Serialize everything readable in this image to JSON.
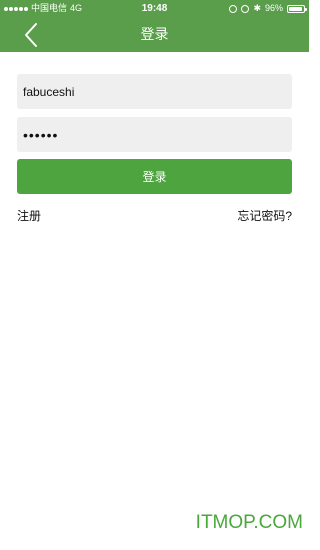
{
  "status_bar": {
    "carrier": "中国电信",
    "network": "4G",
    "time": "19:48",
    "battery": "96%",
    "battery_level": 0.96
  },
  "nav": {
    "title": "登录",
    "back_icon": "chevron-left-icon"
  },
  "form": {
    "username_value": "fabuceshi",
    "password_value": "••••••",
    "login_label": "登录"
  },
  "links": {
    "register": "注册",
    "forgot_password": "忘记密码?"
  },
  "watermark": "ITMOP.COM",
  "colors": {
    "header": "#5a9e4b",
    "button": "#4ea540",
    "field_bg": "#efefef"
  }
}
